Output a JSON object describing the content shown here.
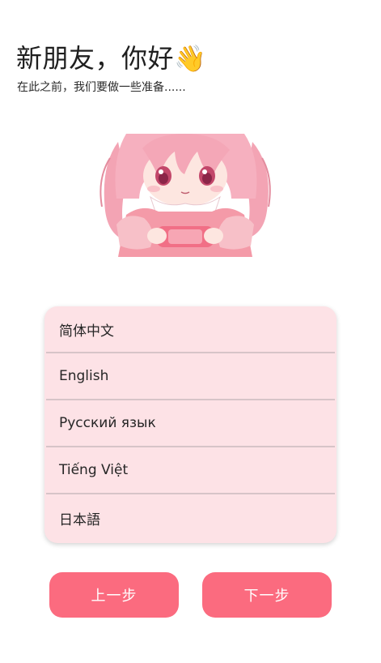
{
  "header": {
    "title": "新朋友，你好",
    "wave_emoji": "👋",
    "subtitle": "在此之前，我们要做一些准备......"
  },
  "languages": [
    "简体中文",
    "English",
    "Русский язык",
    "Tiếng Việt",
    "日本語"
  ],
  "buttons": {
    "prev": "上一步",
    "next": "下一步"
  },
  "colors": {
    "accent": "#fb6b7f",
    "card_bg": "#fde2e6"
  }
}
